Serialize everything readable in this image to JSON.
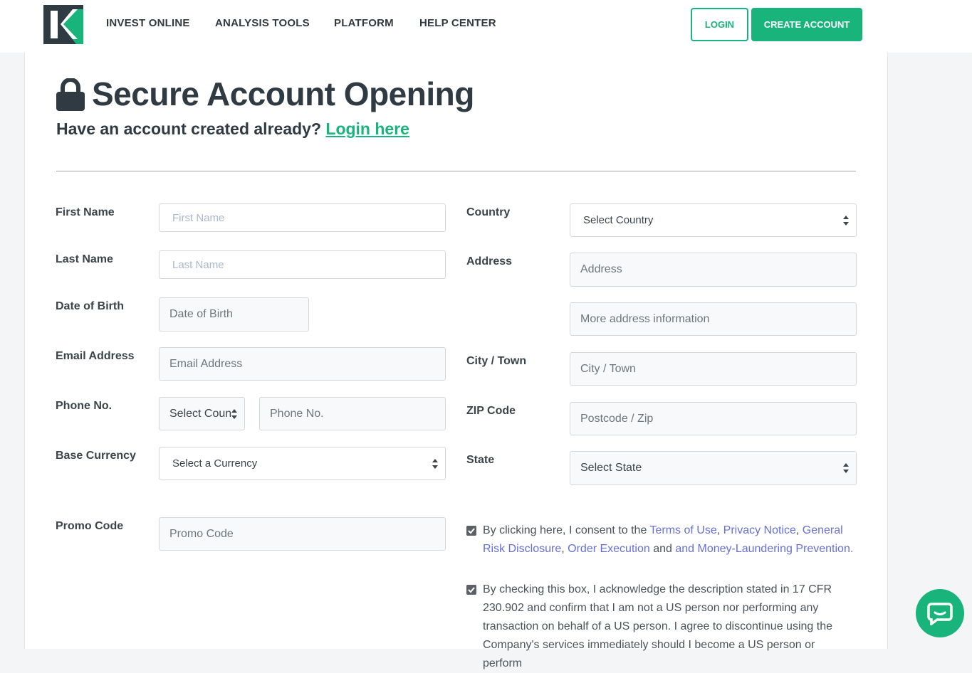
{
  "header": {
    "nav": [
      "INVEST ONLINE",
      "ANALYSIS TOOLS",
      "PLATFORM",
      "HELP CENTER"
    ],
    "login_label": "LOGIN",
    "create_label": "CREATE ACCOUNT"
  },
  "page": {
    "title": "Secure Account Opening",
    "subtitle_text": "Have an account created already?",
    "subtitle_link": "Login here"
  },
  "form": {
    "first_name": {
      "label": "First Name",
      "placeholder": "First Name"
    },
    "last_name": {
      "label": "Last Name",
      "placeholder": "Last Name"
    },
    "dob": {
      "label": "Date of Birth",
      "placeholder": "Date of Birth"
    },
    "email": {
      "label": "Email Address",
      "placeholder": "Email Address"
    },
    "phone": {
      "label": "Phone No.",
      "country_select": "Select Coun",
      "placeholder": "Phone No."
    },
    "currency": {
      "label": "Base Currency",
      "selected": "Select a Currency"
    },
    "promo": {
      "label": "Promo Code",
      "placeholder": "Promo Code"
    },
    "country": {
      "label": "Country",
      "selected": "Select Country"
    },
    "address": {
      "label": "Address",
      "placeholder": "Address",
      "placeholder2": "More address information"
    },
    "city": {
      "label": "City / Town",
      "placeholder": "City / Town"
    },
    "zip": {
      "label": "ZIP Code",
      "placeholder": "Postcode / Zip"
    },
    "state": {
      "label": "State",
      "selected": "Select State"
    }
  },
  "consent1": {
    "prefix": "By clicking here, I consent to the ",
    "terms": "Terms of Use",
    "sep1": ", ",
    "privacy": "Privacy Notice",
    "sep2": ", ",
    "risk": "General Risk Disclosure",
    "sep3": ", ",
    "order": "Order Execution",
    "and": " and ",
    "aml": "and Money-Laundering Prevention."
  },
  "consent2": {
    "text": "By checking this box, I acknowledge the description stated in 17 CFR 230.902 and confirm that I am not a US person nor performing any transaction on behalf of a US person. I agree to discontinue using the Company's services immediately should I become a US person or perform"
  },
  "colors": {
    "accent": "#19b37c",
    "link_blue": "#6670d8",
    "heading": "#2f3a42"
  },
  "icons": [
    "logo-k",
    "lock-icon",
    "select-arrows-icon",
    "checkbox-checked-icon",
    "chat-icon"
  ]
}
